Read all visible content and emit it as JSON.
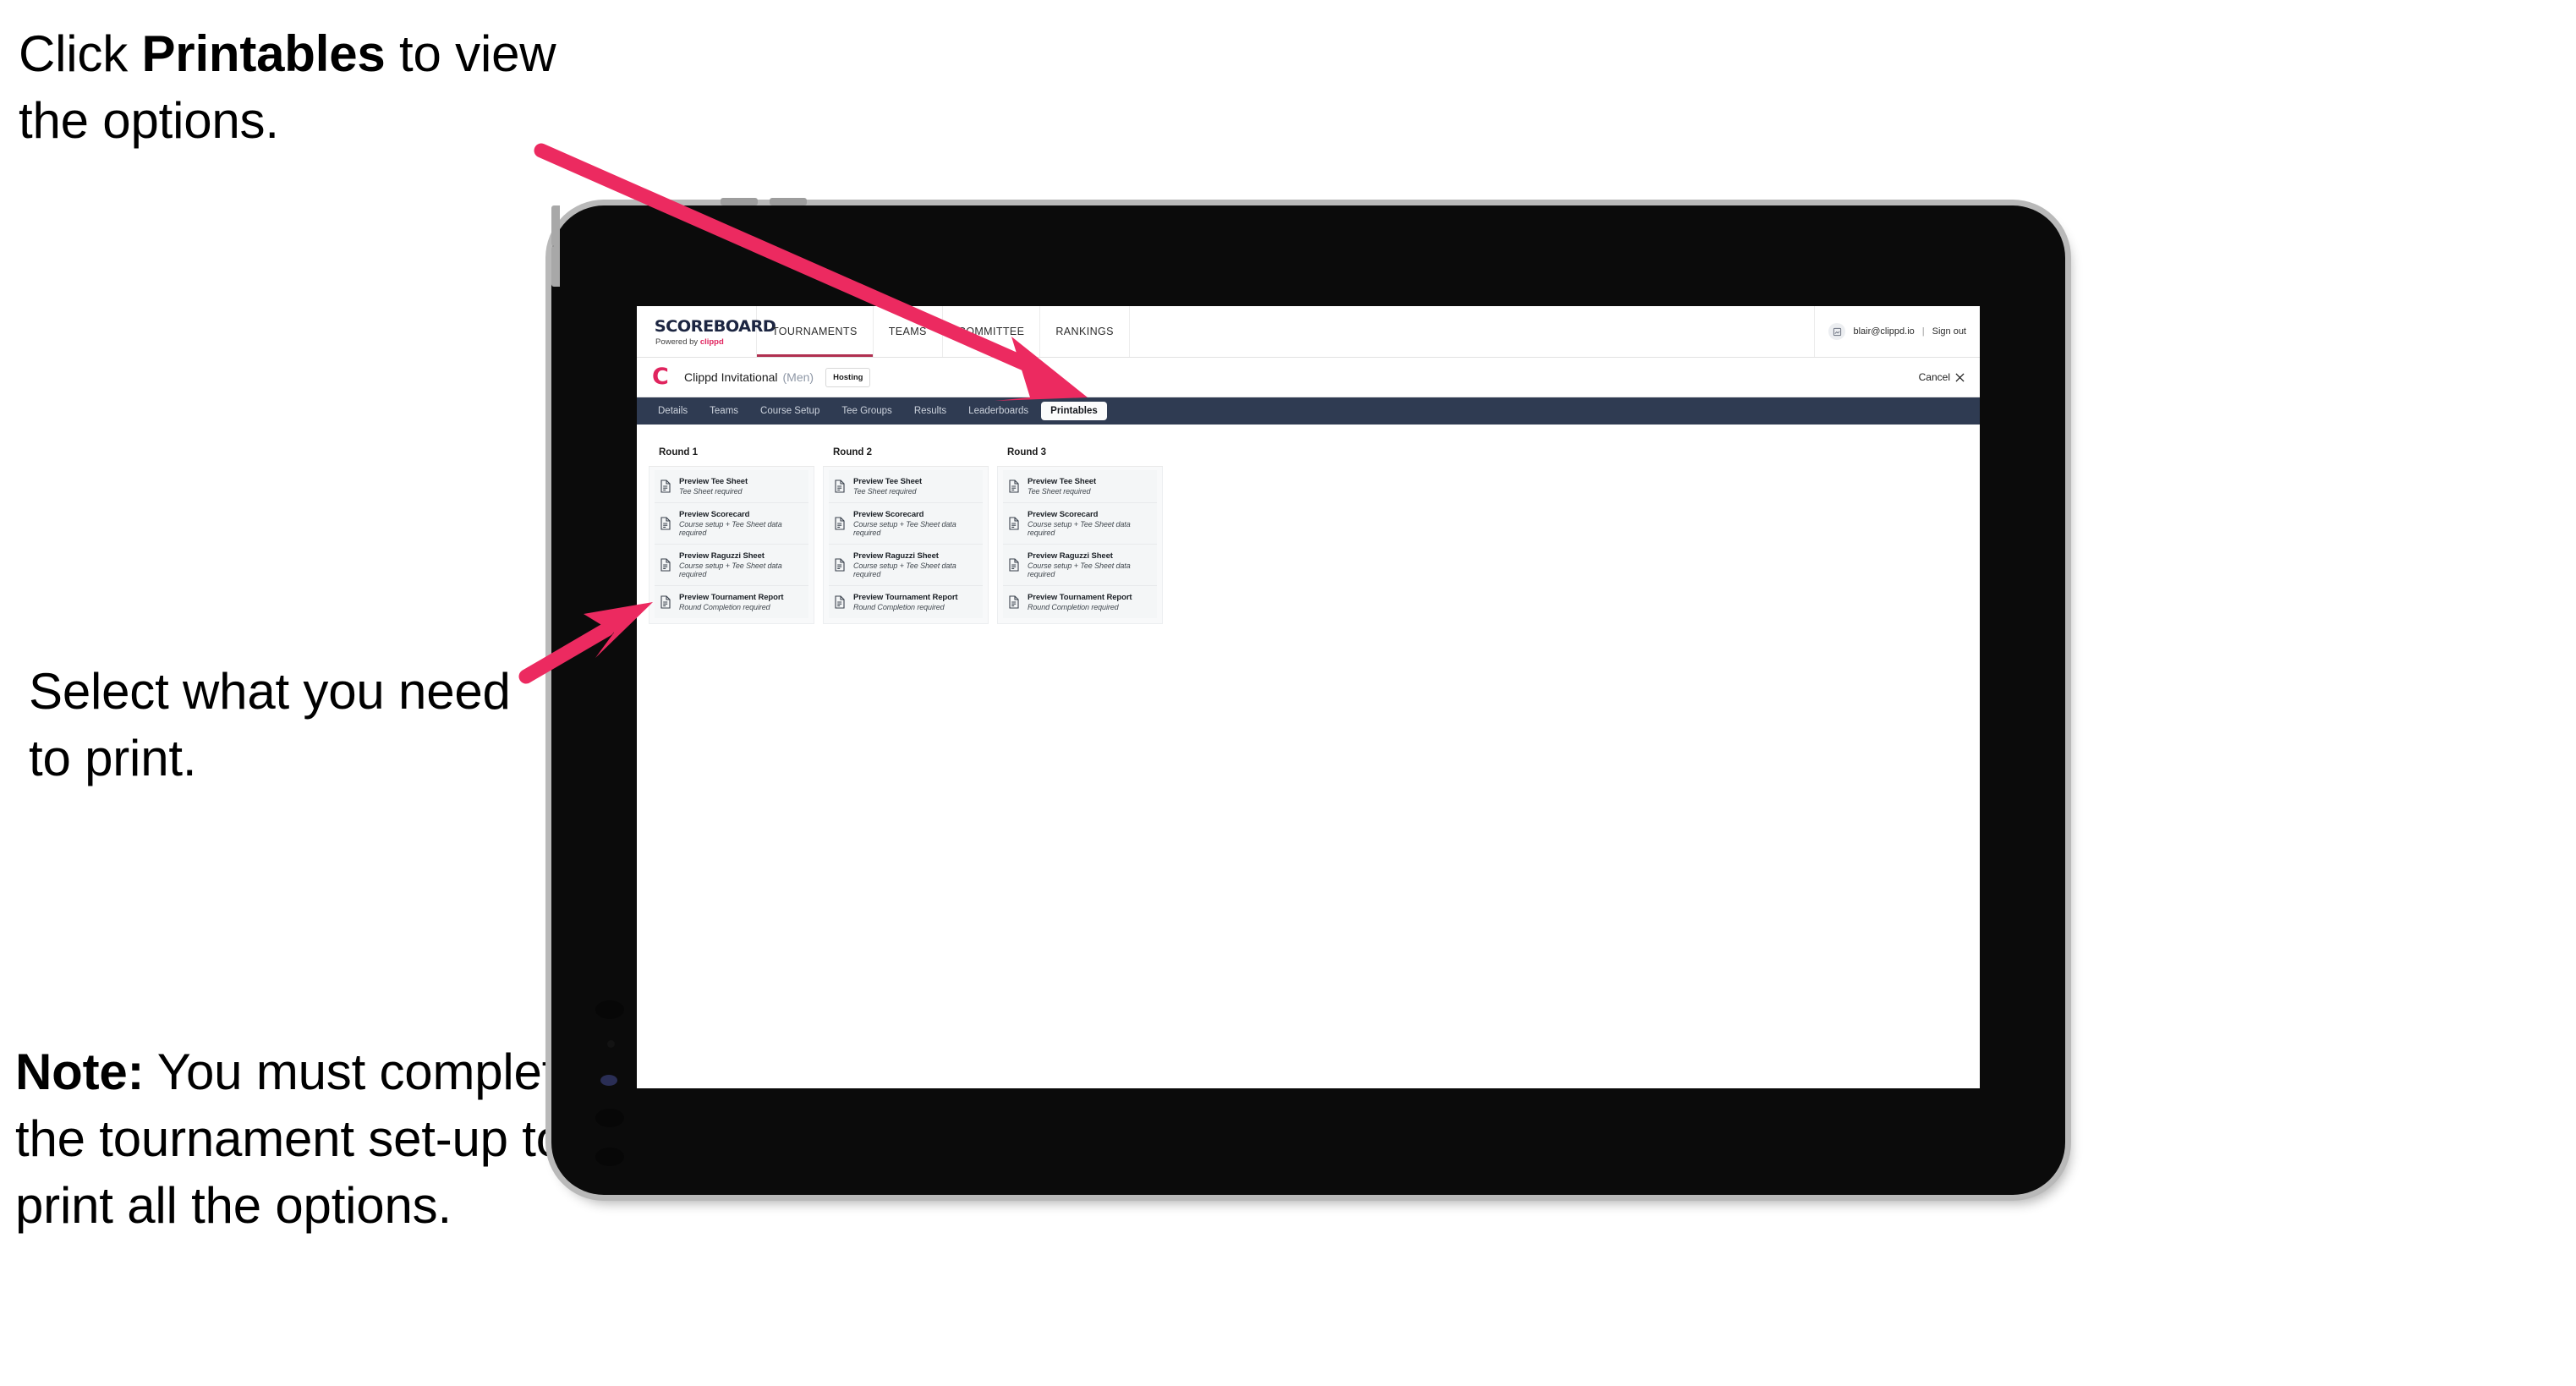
{
  "annotations": {
    "one_pre": "Click ",
    "one_bold": "Printables",
    "one_post": " to view the options.",
    "two": "Select what you need to print.",
    "three_bold": "Note:",
    "three_post": " You must complete the tournament set-up to print all the options.",
    "accent_color": "#ec2a60"
  },
  "app": {
    "logo": {
      "word": "SCOREBOARD",
      "powered_by": "Powered by ",
      "brand": "clippd"
    },
    "topnav": [
      {
        "label": "TOURNAMENTS",
        "active": true
      },
      {
        "label": "TEAMS",
        "active": false
      },
      {
        "label": "COMMITTEE",
        "active": false
      },
      {
        "label": "RANKINGS",
        "active": false
      }
    ],
    "account": {
      "avatar_icon": "user-avatar-icon",
      "email": "blair@clippd.io",
      "separator": "|",
      "sign_out": "Sign out"
    },
    "tournament": {
      "logo_letter": "C",
      "name": "Clippd Invitational",
      "gender": "(Men)",
      "status": "Hosting",
      "cancel_label": "Cancel",
      "cancel_icon": "close-icon"
    },
    "section_tabs": [
      {
        "label": "Details",
        "active": false
      },
      {
        "label": "Teams",
        "active": false
      },
      {
        "label": "Course Setup",
        "active": false
      },
      {
        "label": "Tee Groups",
        "active": false
      },
      {
        "label": "Results",
        "active": false
      },
      {
        "label": "Leaderboards",
        "active": false
      },
      {
        "label": "Printables",
        "active": true
      }
    ],
    "rounds": [
      {
        "title": "Round 1",
        "items": [
          {
            "title": "Preview Tee Sheet",
            "subtitle": "Tee Sheet required",
            "icon": "document-icon"
          },
          {
            "title": "Preview Scorecard",
            "subtitle": "Course setup + Tee Sheet data required",
            "icon": "document-icon"
          },
          {
            "title": "Preview Raguzzi Sheet",
            "subtitle": "Course setup + Tee Sheet data required",
            "icon": "document-icon"
          },
          {
            "title": "Preview Tournament Report",
            "subtitle": "Round Completion required",
            "icon": "document-icon"
          }
        ]
      },
      {
        "title": "Round 2",
        "items": [
          {
            "title": "Preview Tee Sheet",
            "subtitle": "Tee Sheet required",
            "icon": "document-icon"
          },
          {
            "title": "Preview Scorecard",
            "subtitle": "Course setup + Tee Sheet data required",
            "icon": "document-icon"
          },
          {
            "title": "Preview Raguzzi Sheet",
            "subtitle": "Course setup + Tee Sheet data required",
            "icon": "document-icon"
          },
          {
            "title": "Preview Tournament Report",
            "subtitle": "Round Completion required",
            "icon": "document-icon"
          }
        ]
      },
      {
        "title": "Round 3",
        "items": [
          {
            "title": "Preview Tee Sheet",
            "subtitle": "Tee Sheet required",
            "icon": "document-icon"
          },
          {
            "title": "Preview Scorecard",
            "subtitle": "Course setup + Tee Sheet data required",
            "icon": "document-icon"
          },
          {
            "title": "Preview Raguzzi Sheet",
            "subtitle": "Course setup + Tee Sheet data required",
            "icon": "document-icon"
          },
          {
            "title": "Preview Tournament Report",
            "subtitle": "Round Completion required",
            "icon": "document-icon"
          }
        ]
      }
    ]
  }
}
